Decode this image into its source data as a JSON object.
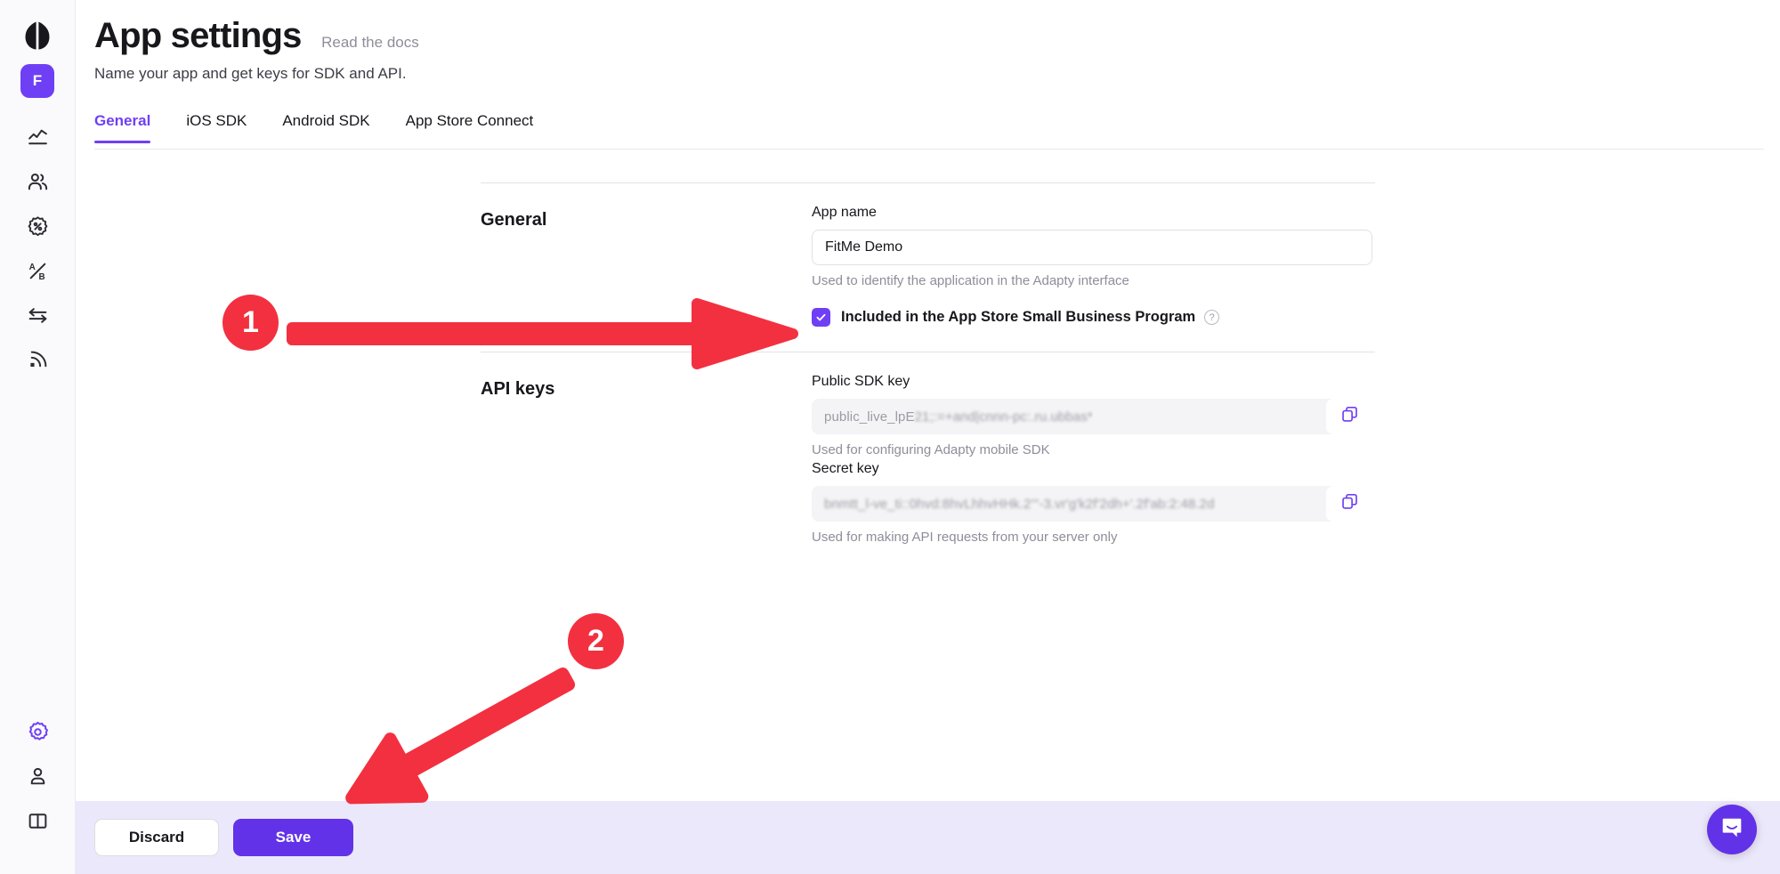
{
  "sidebar": {
    "logo_icon": "adapty-logo-icon",
    "app_badge": "F",
    "items": [
      {
        "icon": "analytics-chart-icon",
        "name": "analytics"
      },
      {
        "icon": "users-group-icon",
        "name": "users"
      },
      {
        "icon": "discount-badge-icon",
        "name": "promo-campaigns"
      },
      {
        "icon": "ab-test-icon",
        "name": "ab-tests"
      },
      {
        "icon": "integrations-arrows-icon",
        "name": "integrations"
      },
      {
        "icon": "events-broadcast-icon",
        "name": "events"
      }
    ],
    "bottom_items": [
      {
        "icon": "gear-icon",
        "name": "settings",
        "active": true
      },
      {
        "icon": "user-profile-icon",
        "name": "profile",
        "active": false
      },
      {
        "icon": "book-docs-icon",
        "name": "documentation",
        "active": false
      }
    ]
  },
  "header": {
    "title": "App settings",
    "docs_link": "Read the docs",
    "subtitle": "Name your app and get keys for SDK and API."
  },
  "tabs": [
    {
      "label": "General",
      "active": true
    },
    {
      "label": "iOS SDK",
      "active": false
    },
    {
      "label": "Android SDK",
      "active": false
    },
    {
      "label": "App Store Connect",
      "active": false
    }
  ],
  "general": {
    "section_title": "General",
    "app_name_label": "App name",
    "app_name_value": "FitMe Demo",
    "app_name_placeholder": "App name",
    "app_name_help": "Used to identify the application in the Adapty interface",
    "sbp_checkbox_label": "Included in the App Store Small Business Program",
    "sbp_checked": true,
    "help_icon_glyph": "?"
  },
  "api_keys": {
    "section_title": "API keys",
    "public_label": "Public SDK key",
    "public_value_visible": "public_live_lpE",
    "public_value_masked": "21;:=+and|cnnn-pc:.ru.ubbas*",
    "public_help": "Used for configuring Adapty mobile SDK",
    "secret_label": "Secret key",
    "secret_value_masked": "bnmtt_l-ve_ti::0hvd:8hvLhhvHHk.2'''-3.vr'g'k2f'2dh+'.2f'ab:2:48.2d",
    "secret_help": "Used for making API requests from your server only",
    "copy_icon": "copy-icon"
  },
  "footer": {
    "discard_label": "Discard",
    "save_label": "Save"
  },
  "support": {
    "intercom_icon": "chat-bubble-icon"
  },
  "annotations": [
    {
      "number": "1",
      "target": "sbp-checkbox",
      "direction": "right"
    },
    {
      "number": "2",
      "target": "save-button",
      "direction": "down-left"
    }
  ],
  "colors": {
    "accent_purple": "#6f3ff5",
    "save_purple": "#6232e8",
    "annotation_red": "#f33040",
    "footer_bg": "#ece8fb",
    "sidebar_bg": "#fafafc"
  }
}
